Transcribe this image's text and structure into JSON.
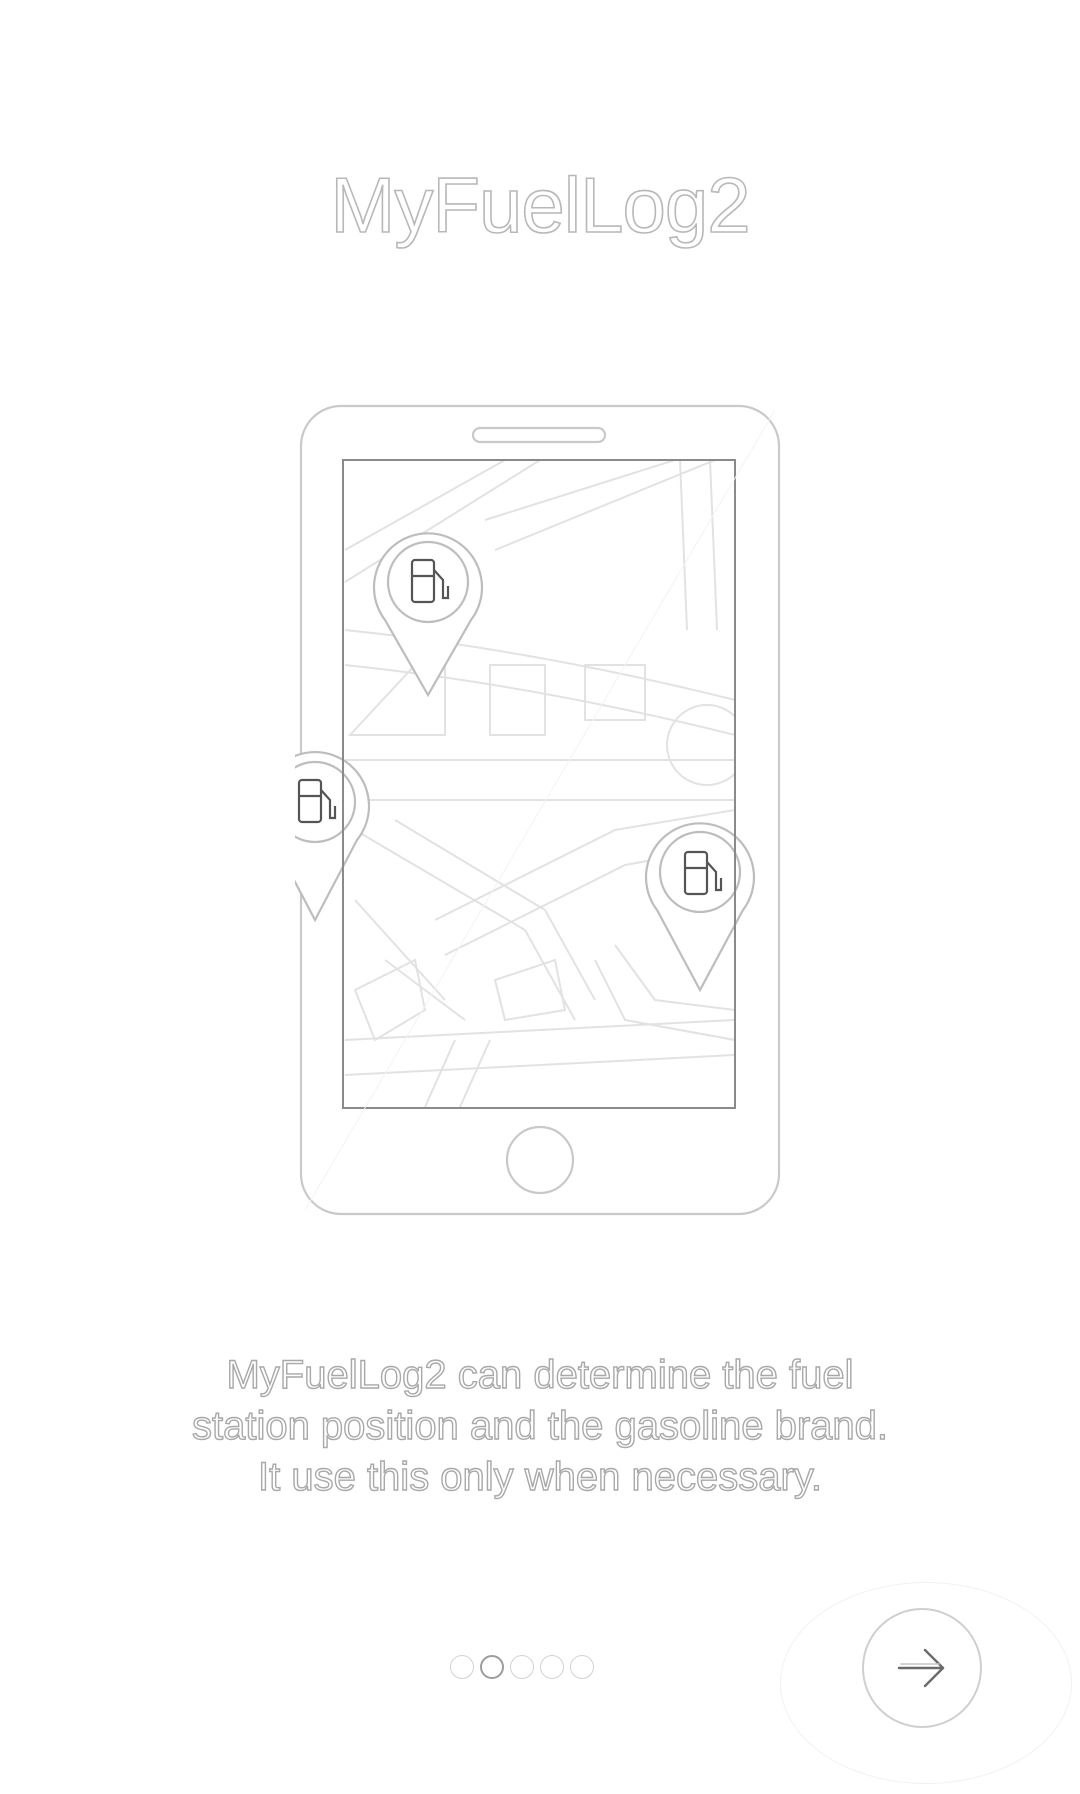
{
  "header": {
    "app_title": "MyFuelLog2"
  },
  "intro": {
    "description_lines": [
      "MyFuelLog2 can determine the fuel",
      "station position and the gasoline brand.",
      "It use this only when necessary."
    ]
  },
  "pager": {
    "page_count": 5,
    "current_page": 2
  },
  "next_button": {
    "icon": "arrow-right-icon"
  },
  "illustration": {
    "icon": "phone-map-fuel-icon",
    "pins": [
      "fuel-pump-icon",
      "fuel-pump-icon",
      "fuel-pump-icon"
    ]
  },
  "colors": {
    "background": "#ffffff",
    "outline": "#b8b8b8",
    "dot_active": "#9c9c9c",
    "dot_inactive": "#d2d2d2"
  }
}
